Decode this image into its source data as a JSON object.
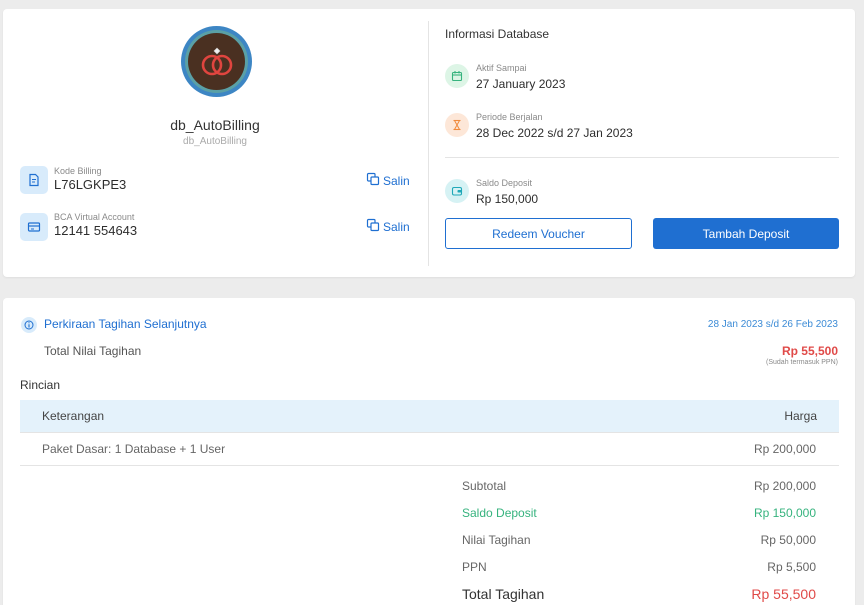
{
  "database": {
    "name": "db_AutoBilling",
    "subname": "db_AutoBilling"
  },
  "billing_code": {
    "label": "Kode Billing",
    "value": "L76LGKPE3",
    "copy_label": "Salin"
  },
  "virtual_account": {
    "label": "BCA Virtual Account",
    "value": "12141 554643",
    "copy_label": "Salin"
  },
  "info": {
    "title": "Informasi Database",
    "active_until_label": "Aktif Sampai",
    "active_until_value": "27 January 2023",
    "period_label": "Periode Berjalan",
    "period_value": "28 Dec 2022 s/d 27 Jan 2023",
    "deposit_label": "Saldo Deposit",
    "deposit_value": "Rp 150,000",
    "redeem_button": "Redeem Voucher",
    "add_deposit_button": "Tambah Deposit"
  },
  "next_bill": {
    "title": "Perkiraan Tagihan Selanjutnya",
    "period": "28 Jan 2023 s/d 26 Feb 2023",
    "total_label": "Total Nilai Tagihan",
    "total_value": "Rp 55,500",
    "ppn_note": "(Sudah termasuk PPN)",
    "details_label": "Rincian",
    "table": {
      "col_description": "Keterangan",
      "col_price": "Harga",
      "rows": [
        {
          "description": "Paket Dasar: 1 Database + 1 User",
          "price": "Rp 200,000"
        }
      ]
    },
    "summary": {
      "subtotal_label": "Subtotal",
      "subtotal_value": "Rp 200,000",
      "deposit_label": "Saldo Deposit",
      "deposit_value": "Rp 150,000",
      "bill_label": "Nilai Tagihan",
      "bill_value": "Rp 50,000",
      "ppn_label": "PPN",
      "ppn_value": "Rp 5,500",
      "grand_label": "Total Tagihan",
      "grand_value": "Rp 55,500"
    }
  },
  "colors": {
    "primary": "#1f6fd1",
    "danger": "#e04a48",
    "success": "#36b37e",
    "table_header": "#e4f2fb"
  },
  "icons": {
    "avatar": "rings-logo-icon",
    "billing_code": "document-icon",
    "virtual_account": "card-icon",
    "copy": "copy-icon",
    "active_until": "calendar-icon",
    "period": "hourglass-icon",
    "deposit": "wallet-icon",
    "info": "info-icon"
  }
}
